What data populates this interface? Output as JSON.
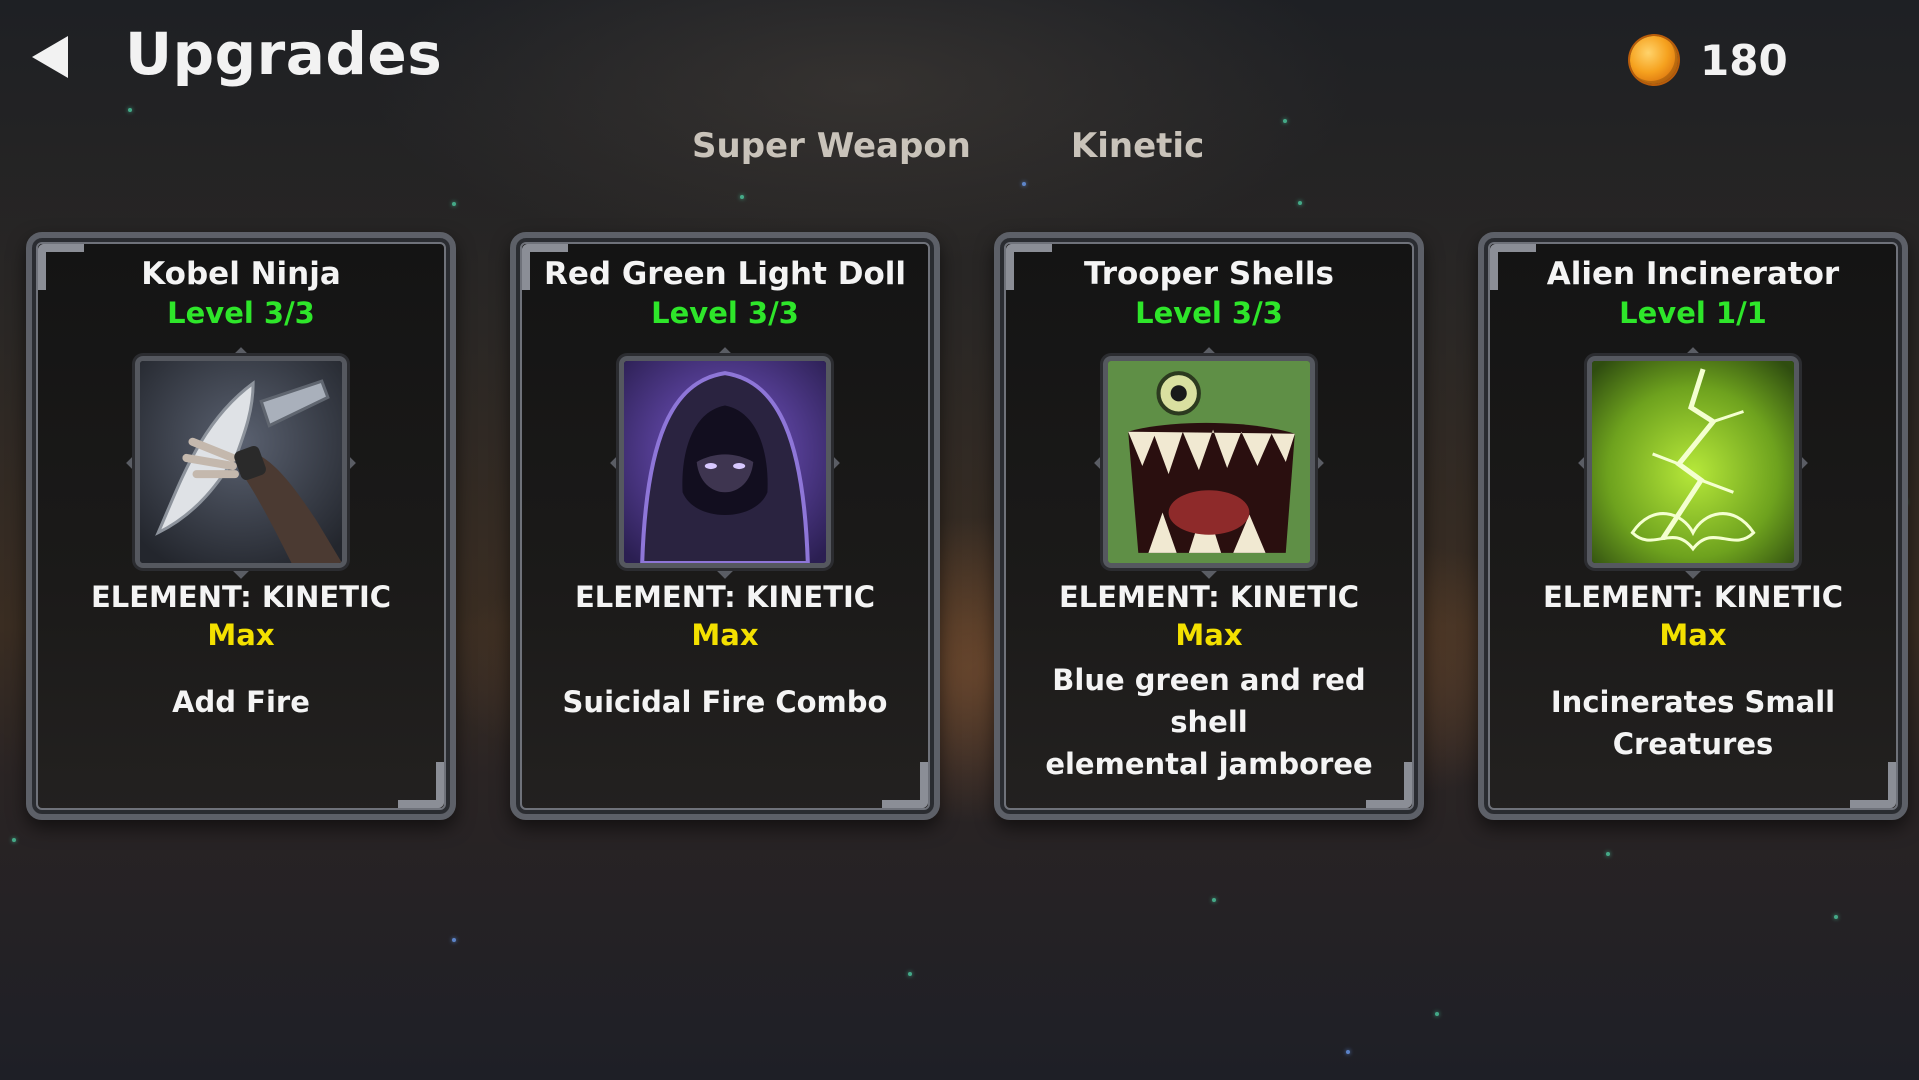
{
  "header": {
    "title": "Upgrades",
    "back_icon": "back-arrow-icon",
    "coins": "180",
    "coin_icon": "coin-icon"
  },
  "tabs": [
    {
      "label": "Super Weapon"
    },
    {
      "label": "Kinetic"
    }
  ],
  "colors": {
    "level": "#2ee62a",
    "max": "#f3e000",
    "card_border": "#5d6068"
  },
  "cards": [
    {
      "name": "Kobel Ninja",
      "level": "Level 3/3",
      "image": "ninja-blade-icon",
      "element": "ELEMENT: KINETIC",
      "status": "Max",
      "description": [
        "Add Fire"
      ]
    },
    {
      "name": "Red Green Light Doll",
      "level": "Level 3/3",
      "image": "hooded-figure-icon",
      "element": "ELEMENT: KINETIC",
      "status": "Max",
      "description": [
        "Suicidal Fire Combo"
      ]
    },
    {
      "name": "Trooper Shells",
      "level": "Level 3/3",
      "image": "fanged-creature-icon",
      "element": "ELEMENT: KINETIC",
      "status": "Max",
      "description": [
        "Blue green and red shell",
        "elemental jamboree"
      ]
    },
    {
      "name": "Alien Incinerator",
      "level": "Level 1/1",
      "image": "green-lightning-icon",
      "element": "ELEMENT: KINETIC",
      "status": "Max",
      "description": [
        "Incinerates Small Creatures"
      ]
    }
  ]
}
